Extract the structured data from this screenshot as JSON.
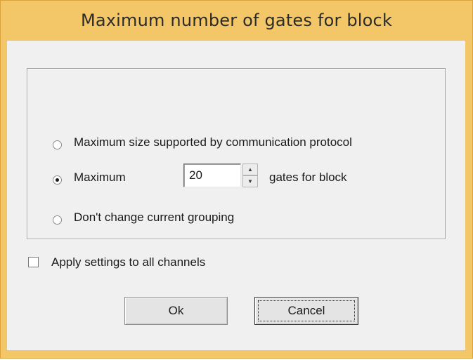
{
  "dialog": {
    "title": "Maximum number of gates for block"
  },
  "options": [
    {
      "label": "Maximum size supported by communication protocol",
      "selected": false
    },
    {
      "label": "Maximum",
      "selected": true
    },
    {
      "label": "Don't change current grouping",
      "selected": false
    }
  ],
  "max_field": {
    "value": "20",
    "suffix": "gates for block"
  },
  "apply_all": {
    "label": "Apply settings to all channels",
    "checked": false
  },
  "buttons": {
    "ok": "Ok",
    "cancel": "Cancel"
  },
  "colors": {
    "title_bar": "#f3c667",
    "client": "#f0f0f0"
  }
}
